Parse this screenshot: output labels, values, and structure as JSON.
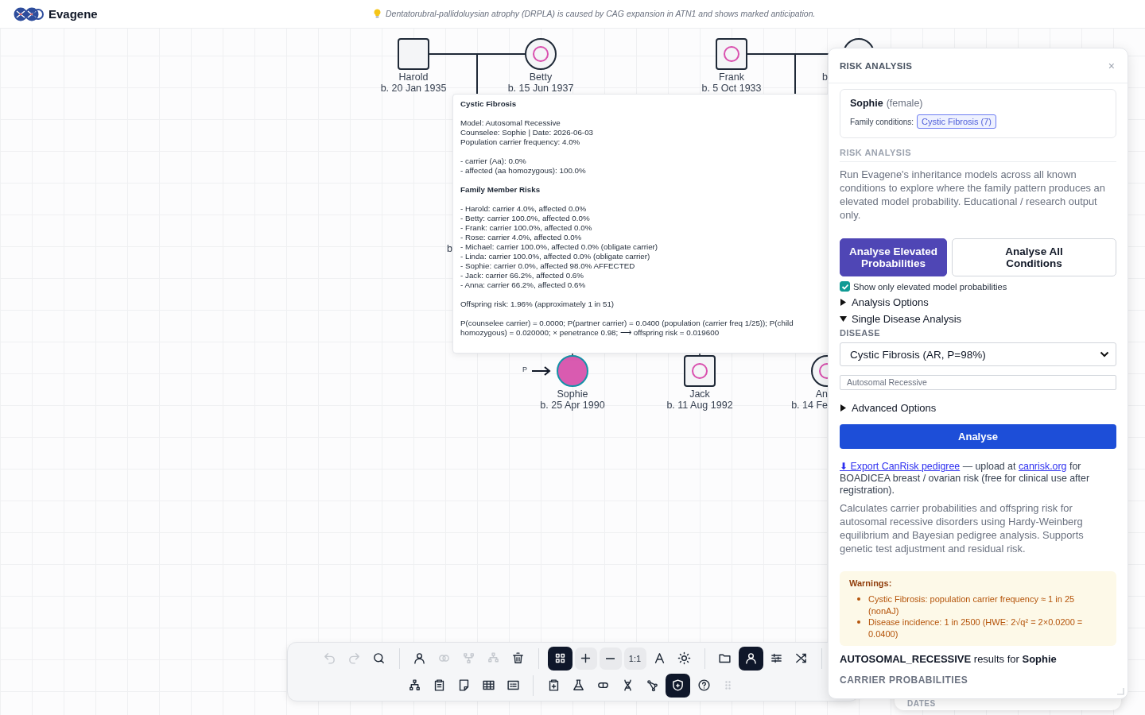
{
  "app": {
    "name": "Evagene",
    "tip": "Dentatorubral-pallidoluysian atrophy (DRPLA) is caused by CAG expansion in ATN1 and shows marked anticipation."
  },
  "pedigree": {
    "persons": [
      {
        "name": "Harold",
        "birth": "b. 20 Jan 1935",
        "kind": "male",
        "carrier": false,
        "affected": false,
        "selected": false
      },
      {
        "name": "Betty",
        "birth": "b. 15 Jun 1937",
        "kind": "female",
        "carrier": true,
        "affected": false,
        "selected": false
      },
      {
        "name": "Frank",
        "birth": "b. 5 Oct 1933",
        "kind": "male",
        "carrier": true,
        "affected": false,
        "selected": false
      },
      {
        "birth": "b",
        "kind": "female",
        "carrier": false,
        "affected": false,
        "selected": false
      },
      {
        "name": "Sophie",
        "birth": "b. 25 Apr 1990",
        "kind": "female",
        "carrier": false,
        "affected": true,
        "selected": true,
        "proband": true,
        "proband_mark": "P"
      },
      {
        "name": "Jack",
        "birth": "b. 11 Aug 1992",
        "kind": "male",
        "carrier": true,
        "affected": false,
        "selected": false
      },
      {
        "name": "An",
        "birth": "b. 14 Fe",
        "kind": "female",
        "carrier": true,
        "affected": false,
        "selected": false
      }
    ],
    "hidden_label": "b"
  },
  "tooltip": {
    "title": "Cystic Fibrosis",
    "model_lines": [
      "Model: Autosomal Recessive",
      "Counselee: Sophie | Date: 2026-06-03",
      "Population carrier frequency: 4.0%"
    ],
    "genotype_lines": [
      "- carrier (Aa): 0.0%",
      "- affected (aa homozygous): 100.0%"
    ],
    "section_title": "Family Member Risks",
    "member_risks": [
      "- Harold: carrier 4.0%, affected 0.0%",
      "- Betty: carrier 100.0%, affected 0.0%",
      "- Frank: carrier 100.0%, affected 0.0%",
      "- Rose: carrier 4.0%, affected 0.0%",
      "- Michael: carrier 100.0%, affected 0.0% (obligate carrier)",
      "- Linda: carrier 100.0%, affected 0.0% (obligate carrier)",
      "- Sophie: carrier 0.0%, affected 98.0% AFFECTED",
      "- Jack: carrier 66.2%, affected 0.6%",
      "- Anna: carrier 66.2%, affected 0.6%"
    ],
    "offspring_risk": "Offspring risk: 1.96% (approximately 1 in 51)",
    "calculation_lines": [
      "P(counselee carrier) = 0.0000; P(partner carrier) = 0.0400 (population (carrier freq 1/25)); P(child",
      "homozygous) = 0.020000; × penetrance 0.98; ⟶ offspring risk = 0.019600"
    ]
  },
  "panel": {
    "title": "RISK ANALYSIS",
    "close": "×",
    "person": {
      "name": "Sophie",
      "sex": "(female)",
      "conditions_label": "Family conditions:",
      "conditions": [
        "Cystic Fibrosis (7)"
      ]
    },
    "section": "RISK ANALYSIS",
    "description": "Run Evagene's inheritance models across all known conditions to explore where the family pattern produces an elevated model probability. Educational / research output only.",
    "buttons": [
      {
        "label": "Analyse Elevated Probabilities",
        "primary": true
      },
      {
        "label": "Analyse All Conditions",
        "primary": false
      }
    ],
    "elevated_only": {
      "label": "Show only elevated model probabilities",
      "checked": true
    },
    "sections": [
      {
        "label": "Analysis Options",
        "expanded": false
      },
      {
        "label": "Single Disease Analysis",
        "expanded": true
      }
    ],
    "disease_label": "DISEASE",
    "disease": "Cystic Fibrosis (AR, P=98%)",
    "model": "Autosomal Recessive",
    "advanced": {
      "label": "Advanced Options",
      "expanded": false
    },
    "analyse": "Analyse",
    "export": {
      "link": "⬇ Export CanRisk pedigree",
      "middle": " — upload at ",
      "site": "canrisk.org",
      "rest": " for BOADICEA breast / ovarian risk (free for clinical use after registration)."
    },
    "about": "Calculates carrier probabilities and offspring risk for autosomal recessive disorders using Hardy-Weinberg equilibrium and Bayesian pedigree analysis. Supports genetic test adjustment and residual risk.",
    "warnings": {
      "title": "Warnings:",
      "items": [
        "Cystic Fibrosis: population carrier frequency ≈ 1 in 25 (nonAJ)",
        "Disease incidence: 1 in 2500 (HWE: 2√q² = 2×0.0200 = 0.0400)"
      ]
    },
    "results": "**AUTOSOMAL_RECESSIVE** results for **Sophie**",
    "subsection": "CARRIER PROBABILITIES"
  },
  "back_panel": {
    "title": "DATES"
  },
  "toolbar": {
    "rows": [
      [
        {
          "kind": "icon",
          "disabled": true,
          "selected": false
        },
        {
          "kind": "icon",
          "disabled": true,
          "selected": false
        },
        {
          "kind": "icon",
          "disabled": false,
          "selected": false
        },
        {
          "kind": "separator"
        },
        {
          "kind": "icon",
          "disabled": false,
          "selected": false
        },
        {
          "kind": "icon",
          "disabled": true,
          "selected": false
        },
        {
          "kind": "icon",
          "disabled": true,
          "selected": false
        },
        {
          "kind": "icon",
          "disabled": true,
          "selected": false
        },
        {
          "kind": "icon",
          "disabled": false,
          "selected": false
        },
        {
          "kind": "separator"
        },
        {
          "kind": "icon",
          "disabled": false,
          "selected": true
        },
        {
          "kind": "zoom",
          "disabled": false,
          "selected": false
        },
        {
          "kind": "zoom",
          "disabled": false,
          "selected": false
        },
        {
          "kind": "zoom",
          "label": "1:1",
          "disabled": false,
          "selected": false
        },
        {
          "kind": "icon",
          "disabled": false,
          "selected": false
        },
        {
          "kind": "icon",
          "disabled": false,
          "selected": false
        },
        {
          "kind": "separator"
        },
        {
          "kind": "icon",
          "disabled": false,
          "selected": false
        },
        {
          "kind": "icon",
          "disabled": false,
          "selected": true
        },
        {
          "kind": "icon",
          "disabled": false,
          "selected": false
        },
        {
          "kind": "icon",
          "disabled": false,
          "selected": false
        },
        {
          "kind": "separator"
        }
      ],
      [
        {
          "kind": "icon",
          "disabled": false,
          "selected": false
        },
        {
          "kind": "icon",
          "disabled": false,
          "selected": false
        },
        {
          "kind": "icon",
          "disabled": false,
          "selected": false
        },
        {
          "kind": "icon",
          "disabled": false,
          "selected": false
        },
        {
          "kind": "icon",
          "disabled": false,
          "selected": false
        },
        {
          "kind": "separator"
        },
        {
          "kind": "icon",
          "disabled": false,
          "selected": false
        },
        {
          "kind": "icon",
          "disabled": false,
          "selected": false
        },
        {
          "kind": "icon",
          "disabled": false,
          "selected": false
        },
        {
          "kind": "icon",
          "disabled": false,
          "selected": false
        },
        {
          "kind": "icon",
          "disabled": false,
          "selected": false
        },
        {
          "kind": "icon",
          "disabled": false,
          "selected": true
        },
        {
          "kind": "icon",
          "disabled": false,
          "selected": false
        },
        {
          "kind": "handle"
        }
      ]
    ]
  }
}
